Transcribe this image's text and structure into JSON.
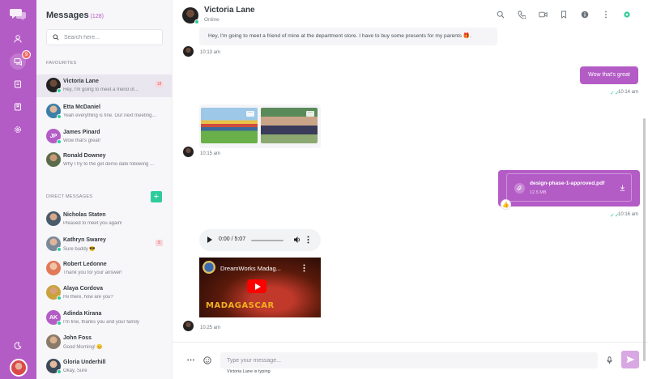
{
  "colors": {
    "primary": "#b45cc6",
    "online": "#2ecc9a",
    "unread_bg": "#f8d7da",
    "unread_text": "#e0606d"
  },
  "sidebar_rail": {
    "badge": "9",
    "icons": [
      "logo-icon",
      "profile-icon",
      "chats-icon",
      "contacts-icon",
      "bookmark-icon",
      "settings-icon",
      "theme-icon"
    ]
  },
  "list": {
    "title": "Messages",
    "count": "(128)",
    "search_placeholder": "Search here...",
    "favourites_label": "FAVOURITES",
    "direct_label": "DIRECT MESSAGES",
    "add_label": "+",
    "favourites": [
      {
        "name": "Victoria Lane",
        "preview": "Hey, I'm going to meet a friend of...",
        "unread": "18",
        "online": true,
        "active": true
      },
      {
        "name": "Etta McDaniel",
        "preview": "Yeah everything is fine. Our next meeting...",
        "unread": "",
        "online": true
      },
      {
        "name": "James Pinard",
        "initials": "JP",
        "preview": "Wow that's great!",
        "unread": "",
        "online": true
      },
      {
        "name": "Ronald Downey",
        "preview": "Why I try to the get demo date following ...",
        "unread": "",
        "online": false
      }
    ],
    "direct": [
      {
        "name": "Nicholas Staten",
        "preview": "Pleased to meet you again!",
        "unread": "",
        "online": false
      },
      {
        "name": "Kathryn Swarey",
        "preview": "Sure buddy 😎",
        "unread": "8",
        "online": true
      },
      {
        "name": "Robert Ledonne",
        "preview": "Thank you for your answer!",
        "unread": "",
        "online": false
      },
      {
        "name": "Alaya Cordova",
        "preview": "Hii there, how are you?",
        "unread": "",
        "online": true
      },
      {
        "name": "Adinda Kirana",
        "initials": "AK",
        "preview": "I'm fine, thanks you and your family",
        "unread": "",
        "online": true
      },
      {
        "name": "John Foss",
        "preview": "Good Morning! 😊",
        "unread": "",
        "online": false
      },
      {
        "name": "Gloria Underhill",
        "preview": "Okay, Sure",
        "unread": "",
        "online": true
      }
    ]
  },
  "chat": {
    "contact_name": "Victoria Lane",
    "status": "Online",
    "header_icons": [
      "search-icon",
      "phone-icon",
      "video-call-icon",
      "bookmark-icon",
      "info-icon",
      "more-vertical-icon",
      "settings-icon"
    ],
    "messages": {
      "m1_text": "Hey, I'm going to meet a friend of mine at the department store. I have to buy some presents for my parents 🎁.",
      "m1_time": "10:13 am",
      "m2_text": "Wow that's great",
      "m2_time": "10:14 am",
      "m3_time": "10:15 am",
      "file_name": "design-phase-1-approved.pdf",
      "file_size": "12.5 MB",
      "file_reaction": "👍",
      "m4_time": "10:16 am",
      "audio_time": "0:00 / 5:07",
      "video_title": "DreamWorks Madag...",
      "video_overlay": "MADAGASCAR",
      "m5_time": "10:25 am"
    },
    "composer_placeholder": "Type your message...",
    "typing_status": "Victoria Lane is typing"
  }
}
